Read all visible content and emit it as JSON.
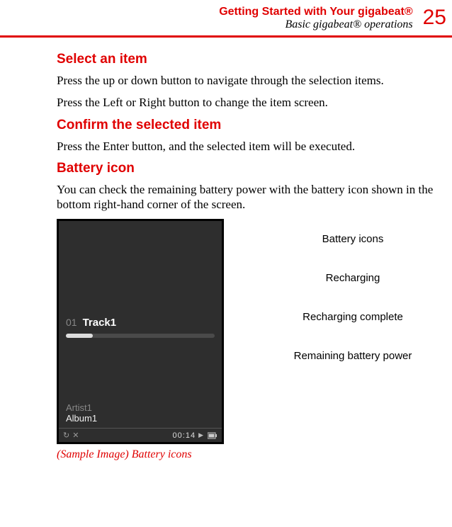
{
  "header": {
    "chapter": "Getting Started with Your gigabeat®",
    "section": "Basic gigabeat® operations",
    "page_number": "25"
  },
  "sections": [
    {
      "heading": "Select an item",
      "paragraphs": [
        "Press the up or down button to navigate through the selection items.",
        "Press the Left or Right button to change the item screen."
      ]
    },
    {
      "heading": "Confirm the selected item",
      "paragraphs": [
        "Press the Enter button, and the selected item will be executed."
      ]
    },
    {
      "heading": "Battery icon",
      "paragraphs": [
        "You can check the remaining battery power with the battery icon shown in the bottom right-hand corner of the screen."
      ]
    }
  ],
  "screenshot": {
    "track_number": "01",
    "track_name": "Track1",
    "artist": "Artist1",
    "album": "Album1",
    "time": "00:14"
  },
  "caption": "(Sample Image) Battery icons",
  "labels": {
    "l1": "Battery icons",
    "l2": "Recharging",
    "l3": "Recharging complete",
    "l4": "Remaining battery power"
  }
}
